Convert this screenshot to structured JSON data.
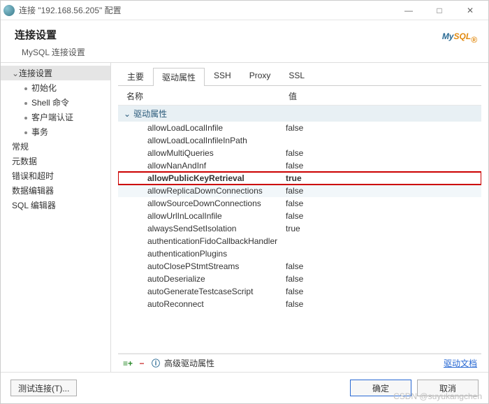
{
  "window": {
    "title": "连接 \"192.168.56.205\" 配置",
    "min_icon": "—",
    "max_icon": "□",
    "close_icon": "✕"
  },
  "header": {
    "title": "连接设置",
    "subtitle": "MySQL 连接设置",
    "logo_my": "My",
    "logo_sql": "SQL",
    "logo_dot": "®"
  },
  "sidebar": {
    "items": [
      {
        "label": "连接设置",
        "level": 1,
        "expandable": true,
        "selected": true
      },
      {
        "label": "初始化",
        "level": 2
      },
      {
        "label": "Shell 命令",
        "level": 2
      },
      {
        "label": "客户端认证",
        "level": 2
      },
      {
        "label": "事务",
        "level": 2
      },
      {
        "label": "常规",
        "level": 1
      },
      {
        "label": "元数据",
        "level": 1
      },
      {
        "label": "错误和超时",
        "level": 1
      },
      {
        "label": "数据编辑器",
        "level": 1
      },
      {
        "label": "SQL 编辑器",
        "level": 1
      }
    ]
  },
  "tabs": {
    "items": [
      {
        "label": "主要"
      },
      {
        "label": "驱动属性",
        "active": true
      },
      {
        "label": "SSH"
      },
      {
        "label": "Proxy"
      },
      {
        "label": "SSL"
      }
    ]
  },
  "grid": {
    "col_name": "名称",
    "col_value": "值",
    "group_label": "驱动属性",
    "rows": [
      {
        "name": "allowLoadLocalInfile",
        "value": "false"
      },
      {
        "name": "allowLoadLocalInfileInPath",
        "value": ""
      },
      {
        "name": "allowMultiQueries",
        "value": "false"
      },
      {
        "name": "allowNanAndInf",
        "value": "false"
      },
      {
        "name": "allowPublicKeyRetrieval",
        "value": "true",
        "highlight": true
      },
      {
        "name": "allowReplicaDownConnections",
        "value": "false",
        "alt": true
      },
      {
        "name": "allowSourceDownConnections",
        "value": "false"
      },
      {
        "name": "allowUrlInLocalInfile",
        "value": "false"
      },
      {
        "name": "alwaysSendSetIsolation",
        "value": "true"
      },
      {
        "name": "authenticationFidoCallbackHandler",
        "value": ""
      },
      {
        "name": "authenticationPlugins",
        "value": ""
      },
      {
        "name": "autoClosePStmtStreams",
        "value": "false"
      },
      {
        "name": "autoDeserialize",
        "value": "false"
      },
      {
        "name": "autoGenerateTestcaseScript",
        "value": "false"
      },
      {
        "name": "autoReconnect",
        "value": "false"
      }
    ],
    "footer_advanced": "高级驱动属性",
    "doc_link": "驱动文档"
  },
  "footer": {
    "test_btn": "测试连接(T)...",
    "ok_btn": "确定",
    "cancel_btn": "取消"
  },
  "watermark": "CSDN @suyukangchen"
}
